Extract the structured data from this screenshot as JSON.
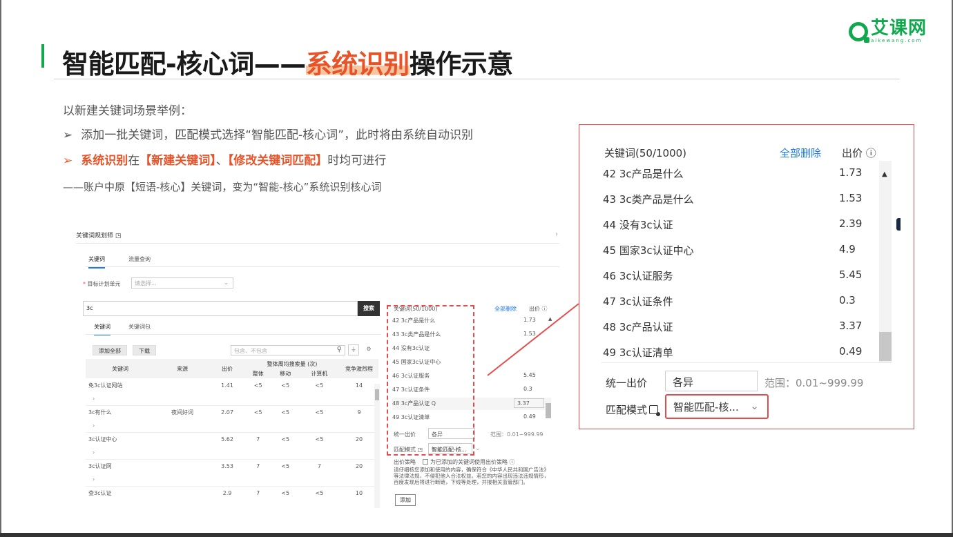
{
  "brand": {
    "name": "艾课网",
    "sub": "aikewang.com",
    "color": "#10a84c"
  },
  "title": {
    "pre": "智能匹配-核心词——",
    "highlight": "系统识别",
    "post": "操作示意"
  },
  "intro": "以新建关键词场景举例：",
  "bullets": {
    "b1_arrow": "➢",
    "b1": "添加一批关键词，匹配模式选择“智能匹配-核心词”，此时将由系统自动识别",
    "b2_arrow": "➢",
    "b2_em1": "系统识别",
    "b2_mid1": "在",
    "b2_em2": "【新建关键词】",
    "b2_mid2": "、",
    "b2_em3": "【修改关键词匹配】",
    "b2_end": "时均可进行"
  },
  "subnote": "——账户中原【短语-核心】关键词，变为“智能-核心”系统识别核心词",
  "mini": {
    "header": "关键词规划师",
    "header_icon": "info-icon",
    "tabs": [
      "关键词",
      "流量查询"
    ],
    "unit_label_req": "*",
    "unit_label": "目标计划单元",
    "unit_placeholder": "请选择...",
    "search_value": "3c",
    "search_button": "搜索",
    "subtabs": [
      "关键词",
      "关键词包"
    ],
    "add_all": "添加全部",
    "download": "下载",
    "filter_placeholder": "包含、不包含",
    "table": {
      "headers": [
        "关键词",
        "来源",
        "出价",
        "整体周均搜索量 (次)",
        "竞争激烈程"
      ],
      "sub_headers": [
        "整体",
        "移动",
        "计算机"
      ],
      "rows": [
        {
          "kw": "免3c认证网站",
          "src": "",
          "bid": "1.41",
          "all": "<5",
          "mob": "<5",
          "pc": "<5",
          "comp": "14"
        },
        {
          "kw": "3c有什么",
          "src": "夜间好词",
          "bid": "2.07",
          "all": "<5",
          "mob": "<5",
          "pc": "<5",
          "comp": "9"
        },
        {
          "kw": "3c认证中心",
          "src": "",
          "bid": "5.62",
          "all": "7",
          "mob": "<5",
          "pc": "<5",
          "comp": "20"
        },
        {
          "kw": "3c认证网",
          "src": "",
          "bid": "3.53",
          "all": "7",
          "mob": "<5",
          "pc": "7",
          "comp": "20"
        },
        {
          "kw": "查3c认证",
          "src": "",
          "bid": "2.9",
          "all": "7",
          "mob": "<5",
          "pc": "<5",
          "comp": "10"
        }
      ]
    },
    "panel": {
      "title": "关键词(50/1000)",
      "delete_all": "全部删除",
      "bid": "出价 ⓘ",
      "rows": [
        {
          "n": "42  3c产品是什么",
          "v": "1.73"
        },
        {
          "n": "43  3c类产品是什么",
          "v": "1.53"
        },
        {
          "n": "44  没有3c认证",
          "v": ""
        },
        {
          "n": "45  国家3c认证中心",
          "v": ""
        },
        {
          "n": "46  3c认证服务",
          "v": "5.45"
        },
        {
          "n": "47  3c认证条件",
          "v": "0.3"
        },
        {
          "n": "48  3c产品认证 Q",
          "v": "3.37"
        },
        {
          "n": "49  3c认证清单",
          "v": "0.49"
        }
      ],
      "unified_bid": "统一出价",
      "unified_value": "各异",
      "range": "范围：0.01~999.99",
      "match_mode": "匹配模式",
      "match_value": "智能匹配-核...",
      "bid_strategy": "出价策略",
      "bid_strategy_check": "为已添加的关键词使用出价策略 ⓘ",
      "notice": "请仔细核您添加和使用的内容，确保符合《中华人民共和国广告法》等法律法规，不侵犯他人合法权益。若您的内容出现违法违规情形，百度发现后将进行断链，下线等处理，并报相关监管部门。",
      "add": "添加"
    }
  },
  "zoom": {
    "title": "关键词(50/1000)",
    "delete_all": "全部删除",
    "bid": "出价 ⓘ",
    "rows": [
      {
        "n": "42  3c产品是什么",
        "v": "1.73"
      },
      {
        "n": "43  3c类产品是什么",
        "v": "1.53"
      },
      {
        "n": "44  没有3c认证",
        "v": "2.39"
      },
      {
        "n": "45  国家3c认证中心",
        "v": "4.9"
      },
      {
        "n": "46  3c认证服务",
        "v": "5.45"
      },
      {
        "n": "47  3c认证条件",
        "v": "0.3"
      },
      {
        "n": "48  3c产品认证",
        "v": "3.37"
      },
      {
        "n": "49  3c认证清单",
        "v": "0.49"
      }
    ],
    "unified_bid": "统一出价",
    "unified_value": "各异",
    "range": "范围：0.01~999.99",
    "match_mode": "匹配模式",
    "match_value": "智能匹配-核...",
    "chevron": "⌄"
  },
  "colors": {
    "accent": "#e8542a",
    "callout": "#e54b4b",
    "link": "#1e7ae6"
  }
}
